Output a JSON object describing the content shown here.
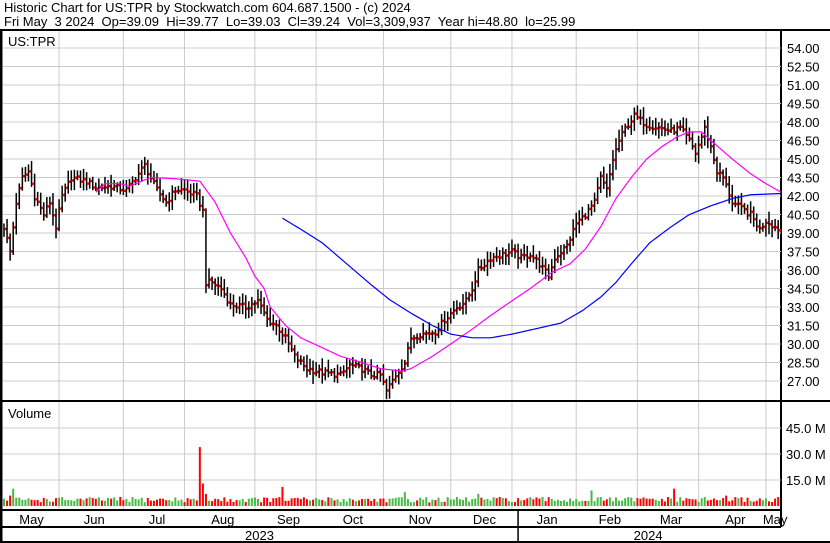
{
  "header": {
    "title": "Historic Chart for US:TPR by Stockwatch.com 604.687.1500 - (c) 2024",
    "quote": "Fri May  3 2024  Op=39.09  Hi=39.77  Lo=39.03  Cl=39.24  Vol=3,309,937  Year hi=48.80  lo=25.99"
  },
  "colors": {
    "bar": "#000000",
    "close_tick": "#ff0000",
    "ma_short": "#ff00ff",
    "ma_long": "#0000ff",
    "vol_up": "#44bb44",
    "vol_down": "#ff0000",
    "grid": "#cccccc"
  },
  "chart_data": {
    "type": "ohlc",
    "symbol": "US:TPR",
    "trading_days": 254,
    "price_axis": {
      "ticks": [
        "54.00",
        "52.50",
        "51.00",
        "49.50",
        "48.00",
        "46.50",
        "45.00",
        "43.50",
        "42.00",
        "40.50",
        "39.00",
        "37.50",
        "36.00",
        "34.50",
        "33.00",
        "31.50",
        "30.00",
        "28.50",
        "27.00"
      ],
      "ylim": [
        25.5,
        55.0
      ]
    },
    "close_keypoints": [
      [
        0,
        39.5
      ],
      [
        2,
        37.5
      ],
      [
        4,
        41.5
      ],
      [
        6,
        43.5
      ],
      [
        8,
        44
      ],
      [
        10,
        42
      ],
      [
        13,
        40.5
      ],
      [
        15,
        41.5
      ],
      [
        17,
        39.5
      ],
      [
        19,
        42
      ],
      [
        22,
        43.5
      ],
      [
        27,
        43.2
      ],
      [
        30,
        42.7
      ],
      [
        35,
        42.8
      ],
      [
        40,
        42.5
      ],
      [
        43,
        43.5
      ],
      [
        46,
        44.5
      ],
      [
        50,
        42.5
      ],
      [
        53,
        41.5
      ],
      [
        56,
        42.5
      ],
      [
        59,
        42.5
      ],
      [
        63,
        42
      ],
      [
        65,
        40.8
      ],
      [
        66,
        35
      ],
      [
        68,
        35
      ],
      [
        71,
        34.5
      ],
      [
        74,
        33.2
      ],
      [
        79,
        33
      ],
      [
        83,
        33.5
      ],
      [
        86,
        32
      ],
      [
        89,
        31.5
      ],
      [
        92,
        30.5
      ],
      [
        95,
        29
      ],
      [
        99,
        28
      ],
      [
        104,
        27.7
      ],
      [
        110,
        27.5
      ],
      [
        113,
        28.3
      ],
      [
        117,
        28
      ],
      [
        120,
        27.5
      ],
      [
        123,
        27.5
      ],
      [
        125,
        26.2
      ],
      [
        128,
        27.5
      ],
      [
        131,
        28.5
      ],
      [
        133,
        30.5
      ],
      [
        136,
        30.8
      ],
      [
        141,
        31
      ],
      [
        144,
        32
      ],
      [
        148,
        33
      ],
      [
        151,
        33.5
      ],
      [
        153,
        34.5
      ],
      [
        155,
        36
      ],
      [
        159,
        37
      ],
      [
        162,
        37.2
      ],
      [
        166,
        37.5
      ],
      [
        169,
        37
      ],
      [
        172,
        37.3
      ],
      [
        175,
        36.5
      ],
      [
        178,
        35.5
      ],
      [
        180,
        37
      ],
      [
        184,
        38
      ],
      [
        187,
        39.8
      ],
      [
        190,
        40.5
      ],
      [
        193,
        41.5
      ],
      [
        195,
        43.5
      ],
      [
        197,
        42.5
      ],
      [
        199,
        45
      ],
      [
        201,
        46.5
      ],
      [
        203,
        47.5
      ],
      [
        206,
        48.5
      ],
      [
        210,
        47.8
      ],
      [
        215,
        47.5
      ],
      [
        218,
        47.3
      ],
      [
        221,
        47.5
      ],
      [
        224,
        46.5
      ],
      [
        226,
        45.5
      ],
      [
        229,
        47.5
      ],
      [
        231,
        46
      ],
      [
        233,
        44
      ],
      [
        235,
        43.5
      ],
      [
        238,
        41.5
      ],
      [
        241,
        41
      ],
      [
        244,
        40.5
      ],
      [
        247,
        39.3
      ],
      [
        249,
        40
      ],
      [
        251,
        39.7
      ],
      [
        253,
        39.24
      ]
    ],
    "ma_short_keypoints": [
      [
        30,
        42.3
      ],
      [
        33,
        43
      ],
      [
        38,
        43
      ],
      [
        41,
        42.8
      ],
      [
        48,
        43.5
      ],
      [
        56,
        43.4
      ],
      [
        64,
        43.2
      ],
      [
        69,
        41.5
      ],
      [
        74,
        39
      ],
      [
        79,
        37
      ],
      [
        82,
        35.5
      ],
      [
        85,
        34.5
      ],
      [
        87,
        33
      ],
      [
        92,
        31.5
      ],
      [
        97,
        30.5
      ],
      [
        104,
        29.7
      ],
      [
        110,
        29
      ],
      [
        117,
        28.5
      ],
      [
        123,
        28
      ],
      [
        130,
        27.8
      ],
      [
        133,
        28
      ],
      [
        140,
        29
      ],
      [
        146,
        30
      ],
      [
        153,
        31.2
      ],
      [
        159,
        32.3
      ],
      [
        166,
        33.5
      ],
      [
        172,
        34.5
      ],
      [
        179,
        35.8
      ],
      [
        185,
        36.5
      ],
      [
        190,
        37.7
      ],
      [
        195,
        39.5
      ],
      [
        200,
        41.8
      ],
      [
        205,
        43.5
      ],
      [
        210,
        45
      ],
      [
        215,
        46
      ],
      [
        220,
        46.8
      ],
      [
        224,
        47.2
      ],
      [
        228,
        47.2
      ],
      [
        231,
        46.5
      ],
      [
        238,
        45
      ],
      [
        244,
        43.8
      ],
      [
        249,
        43
      ],
      [
        254,
        42.3
      ]
    ],
    "ma_long_keypoints": [
      [
        91,
        40.2
      ],
      [
        97,
        39.3
      ],
      [
        104,
        38.2
      ],
      [
        112,
        36.5
      ],
      [
        120,
        34.8
      ],
      [
        126,
        33.6
      ],
      [
        133,
        32.5
      ],
      [
        140,
        31.5
      ],
      [
        146,
        30.8
      ],
      [
        153,
        30.5
      ],
      [
        159,
        30.5
      ],
      [
        166,
        30.8
      ],
      [
        175,
        31.3
      ],
      [
        182,
        31.7
      ],
      [
        189,
        32.7
      ],
      [
        195,
        33.8
      ],
      [
        200,
        35
      ],
      [
        205,
        36.5
      ],
      [
        211,
        38.2
      ],
      [
        218,
        39.5
      ],
      [
        224,
        40.5
      ],
      [
        231,
        41.2
      ],
      [
        238,
        41.8
      ],
      [
        244,
        42.1
      ],
      [
        254,
        42.2
      ]
    ],
    "volume": {
      "label": "Volume",
      "ticks": [
        "45.0 M",
        "30.0 M",
        "15.0 M"
      ],
      "ylim_millions": [
        0,
        55
      ],
      "baseline_millions": 3.5,
      "spikes_millions": [
        [
          2,
          6
        ],
        [
          3,
          10
        ],
        [
          64,
          34
        ],
        [
          65,
          13
        ],
        [
          66,
          7
        ],
        [
          91,
          11
        ],
        [
          131,
          8
        ],
        [
          155,
          7
        ],
        [
          192,
          9
        ],
        [
          219,
          10
        ],
        [
          236,
          6
        ]
      ]
    },
    "months": [
      {
        "label": "May",
        "start": 0
      },
      {
        "label": "Jun",
        "start": 20
      },
      {
        "label": "Jul",
        "start": 41
      },
      {
        "label": "Aug",
        "start": 61
      },
      {
        "label": "Sep",
        "start": 84
      },
      {
        "label": "Oct",
        "start": 104
      },
      {
        "label": "Nov",
        "start": 126
      },
      {
        "label": "Dec",
        "start": 148
      },
      {
        "label": "Jan",
        "start": 168
      },
      {
        "label": "Feb",
        "start": 189
      },
      {
        "label": "Mar",
        "start": 209
      },
      {
        "label": "Apr",
        "start": 229
      },
      {
        "label": "May",
        "start": 251
      }
    ],
    "years": [
      {
        "label": "2023",
        "start": 0
      },
      {
        "label": "2024",
        "start": 167
      }
    ]
  }
}
